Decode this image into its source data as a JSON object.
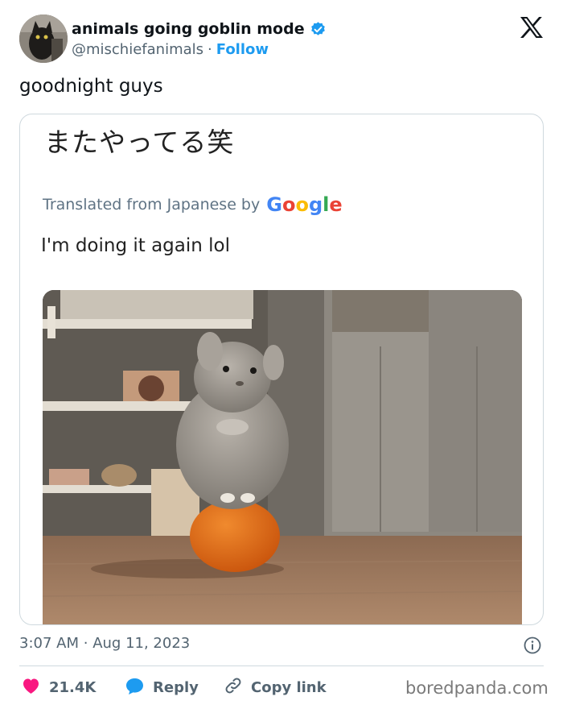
{
  "header": {
    "display_name": "animals going goblin mode",
    "handle": "@mischiefanimals",
    "separator": "·",
    "follow_label": "Follow"
  },
  "icons": {
    "brand": "x-logo-icon",
    "verified": "verified-badge-icon",
    "info": "info-icon",
    "like": "heart-icon",
    "reply": "speech-bubble-icon",
    "copy_link": "link-icon"
  },
  "tweet": {
    "text": "goodnight guys"
  },
  "embedded": {
    "original_text": "またやってる笑",
    "translated_label": "Translated from Japanese by",
    "translator_brand": "Google",
    "translation": "I'm doing it again lol",
    "photo_description": "chinchilla standing on an orange"
  },
  "meta": {
    "time": "3:07 AM",
    "separator": "·",
    "date": "Aug 11, 2023"
  },
  "actions": {
    "like_count": "21.4K",
    "reply_label": "Reply",
    "copy_link_label": "Copy link"
  },
  "watermark": "boredpanda.com",
  "colors": {
    "accent": "#1d9bf0",
    "like": "#f91880",
    "muted": "#536471",
    "border": "#cfd9de"
  }
}
